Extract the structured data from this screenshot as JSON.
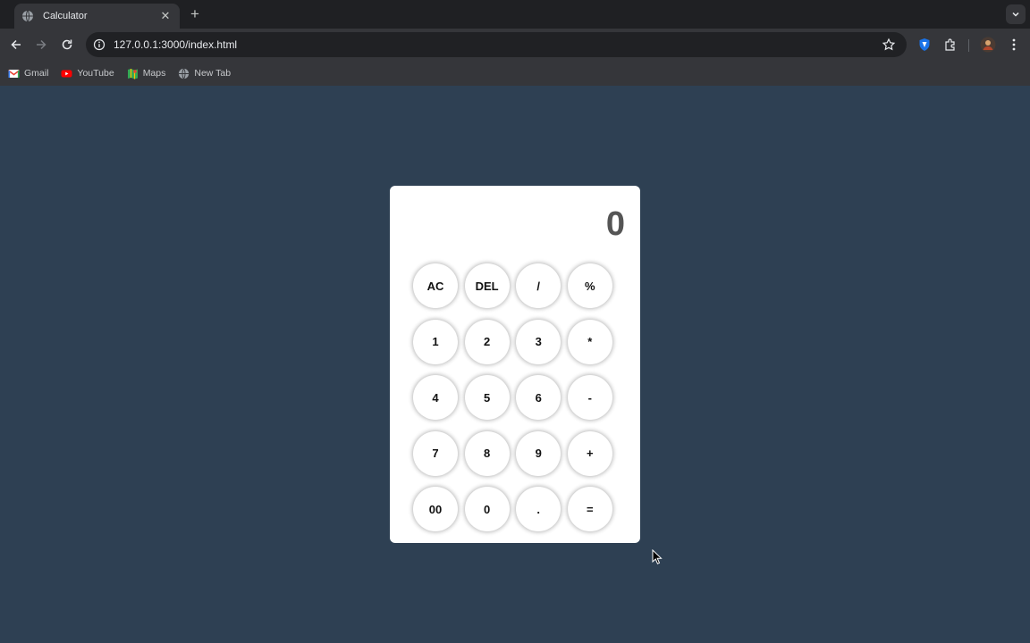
{
  "browser": {
    "tab": {
      "title": "Calculator",
      "favicon": "globe-icon"
    },
    "address": {
      "url": "127.0.0.1:3000/index.html"
    },
    "bookmarks": [
      {
        "label": "Gmail",
        "icon": "gmail-icon"
      },
      {
        "label": "YouTube",
        "icon": "youtube-icon"
      },
      {
        "label": "Maps",
        "icon": "maps-icon"
      },
      {
        "label": "New Tab",
        "icon": "globe-icon"
      }
    ]
  },
  "calculator": {
    "display": "0",
    "keys": [
      [
        "AC",
        "DEL",
        "/",
        "%"
      ],
      [
        "1",
        "2",
        "3",
        "*"
      ],
      [
        "4",
        "5",
        "6",
        "-"
      ],
      [
        "7",
        "8",
        "9",
        "+"
      ],
      [
        "00",
        "0",
        ".",
        "="
      ]
    ]
  },
  "colors": {
    "page_background": "#2e4053",
    "calculator_background": "#ffffff",
    "display_text": "#555555"
  }
}
